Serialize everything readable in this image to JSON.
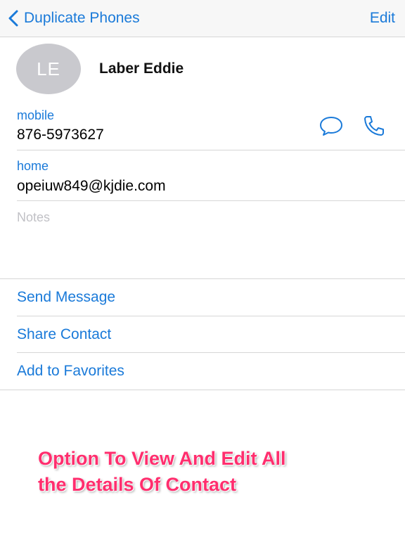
{
  "navbar": {
    "back_label": "Duplicate Phones",
    "edit_label": "Edit"
  },
  "contact": {
    "initials": "LE",
    "name": "Laber Eddie"
  },
  "fields": {
    "phone_label": "mobile",
    "phone_value": "876-5973627",
    "email_label": "home",
    "email_value": "opeiuw849@kjdie.com",
    "notes_placeholder": "Notes"
  },
  "actions": {
    "send_message": "Send Message",
    "share_contact": "Share Contact",
    "add_favorites": "Add to Favorites"
  },
  "caption": {
    "line1": "Option To View And Edit All",
    "line2": "the Details Of Contact"
  },
  "colors": {
    "accent": "#1a7ad9",
    "caption": "#ff2e6e",
    "avatar_bg": "#c9c9ce",
    "divider": "#d6d6d6"
  }
}
